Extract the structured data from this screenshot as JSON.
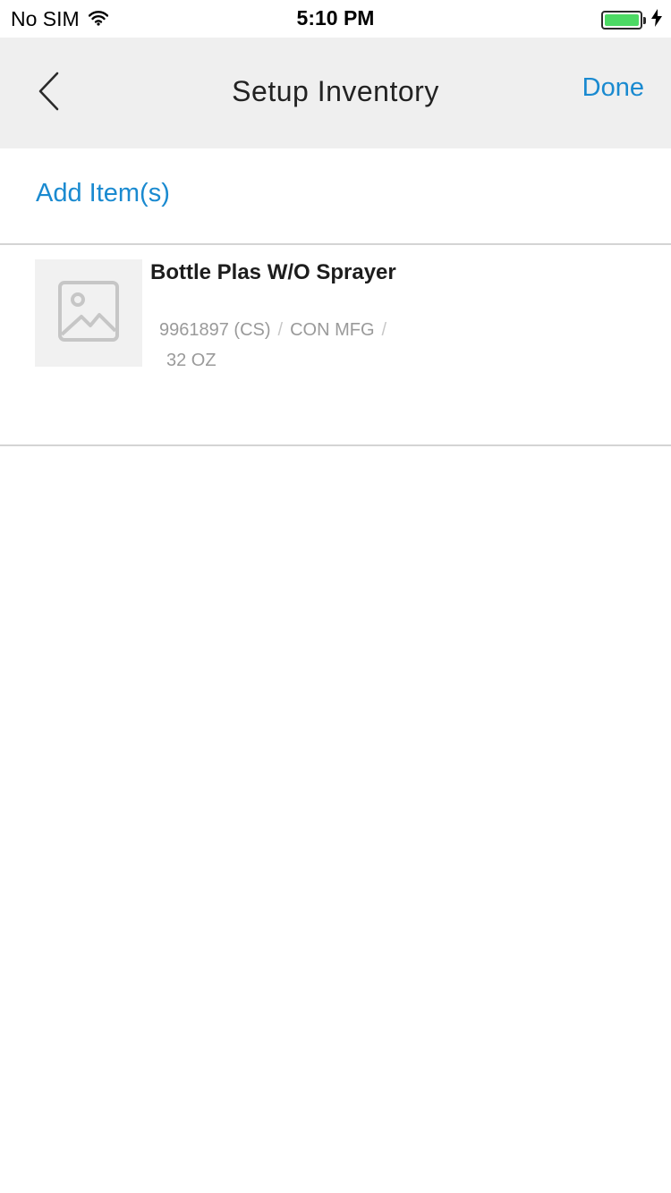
{
  "status_bar": {
    "carrier": "No SIM",
    "time": "5:10 PM",
    "battery_level": 1.0,
    "battery_color": "#4cd964"
  },
  "nav": {
    "title": "Setup Inventory",
    "done_label": "Done",
    "back_icon": "chevron-left-icon",
    "accent_color": "#1a8ad0"
  },
  "add_items": {
    "label": "Add Item(s)"
  },
  "items": [
    {
      "name": "Bottle Plas W/O Sprayer",
      "item_number": "9961897 (CS)",
      "brand": "CON MFG",
      "pack_size": "32 OZ",
      "separator": "/",
      "image_icon": "image-placeholder-icon"
    }
  ]
}
